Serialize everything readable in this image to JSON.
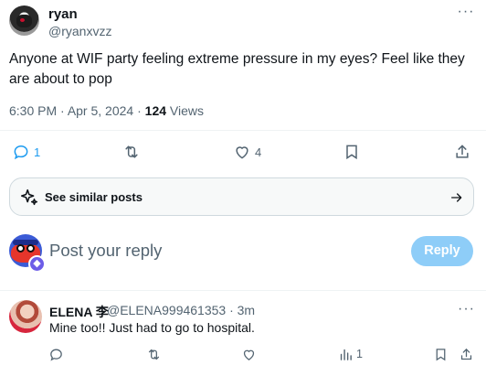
{
  "post": {
    "author_name": "ryan",
    "author_handle": "@ryanxvzz",
    "more": "···",
    "text": "Anyone at WIF party feeling extreme pressure in my eyes? Feel like they are about to pop",
    "time": "6:30 PM",
    "date": "Apr 5, 2024",
    "views_count": "124",
    "views_label": "Views"
  },
  "actions": {
    "reply_count": "1",
    "like_count": "4"
  },
  "similar": {
    "label": "See similar posts"
  },
  "reply_box": {
    "placeholder": "Post your reply",
    "button_label": "Reply",
    "badge_icon": "ethereum-icon"
  },
  "comment": {
    "name": "ELENA 李",
    "handle_time": "@ELENA999461353 · 3m",
    "text": "Mine too!! Just had to go to hospital.",
    "more": "···",
    "views_count": "1"
  },
  "colors": {
    "accent_disabled": "#8ecdf8",
    "text_primary": "#0f1419",
    "text_secondary": "#536471",
    "reply_icon_active": "#1d9bf0"
  },
  "icons": [
    "reply-icon",
    "retweet-icon",
    "heart-icon",
    "bookmark-icon",
    "share-icon",
    "sparkle-icon",
    "arrow-right-icon",
    "views-icon"
  ]
}
